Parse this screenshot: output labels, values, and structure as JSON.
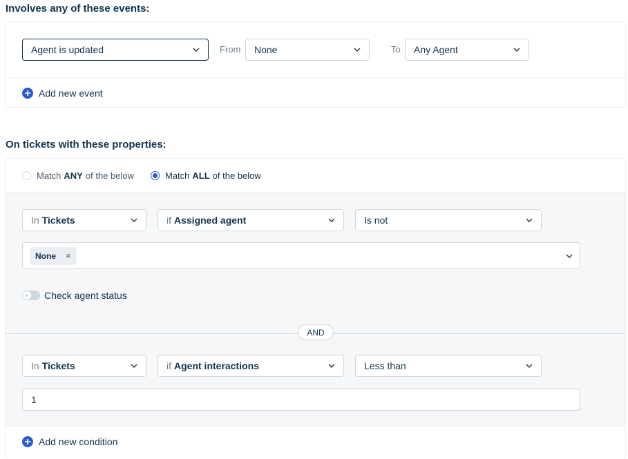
{
  "events_section": {
    "title": "Involves any of these events:",
    "event_select": "Agent is updated",
    "from_label": "From",
    "from_select": "None",
    "to_label": "To",
    "to_select": "Any Agent",
    "add_event": "Add new event"
  },
  "properties_section": {
    "title": "On tickets with these properties:",
    "match_any": {
      "prefix": "Match",
      "bold": "ANY",
      "suffix": "of the below",
      "selected": false
    },
    "match_all": {
      "prefix": "Match",
      "bold": "ALL",
      "suffix": "of the below",
      "selected": true
    },
    "condition1": {
      "scope_prefix": "In",
      "scope": "Tickets",
      "field_prefix": "if",
      "field": "Assigned agent",
      "operator": "Is not",
      "tag": "None",
      "check_agent_status": "Check agent status",
      "check_agent_status_on": false
    },
    "joiner": "AND",
    "condition2": {
      "scope_prefix": "In",
      "scope": "Tickets",
      "field_prefix": "if",
      "field": "Agent interactions",
      "operator": "Less than",
      "value": "1"
    },
    "add_condition": "Add new condition"
  },
  "colors": {
    "accent": "#2c5cc5",
    "text": "#12344d",
    "border": "#cfd7df",
    "panel": "#f5f7f9"
  }
}
